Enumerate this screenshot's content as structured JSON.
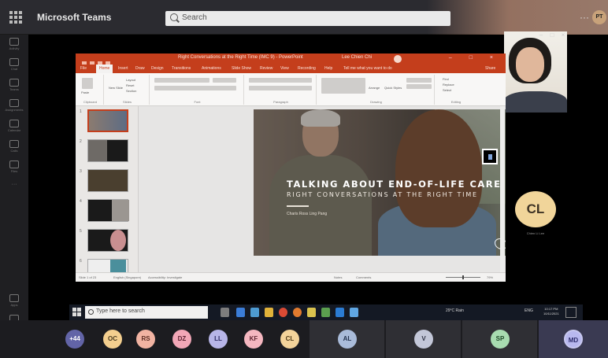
{
  "teams": {
    "app_title": "Microsoft Teams",
    "search_placeholder": "Search",
    "more": "···",
    "user_initials": "PT"
  },
  "rail": {
    "items": [
      "Activity",
      "Chat",
      "Teams",
      "Assignments",
      "Calendar",
      "Calls",
      "Files",
      "···"
    ],
    "bottom": [
      "Apps",
      "Help"
    ]
  },
  "self_window": {
    "controls": [
      "–",
      "□",
      "×"
    ]
  },
  "powerpoint": {
    "title": "Right Conversations at the Right Time (IMC 9) - PowerPoint",
    "user_name": "Lee Chien Chi",
    "tabs": [
      "File",
      "Home",
      "Insert",
      "Draw",
      "Design",
      "Transitions",
      "Animations",
      "Slide Show",
      "Review",
      "View",
      "Recording",
      "Help",
      "Tell me what you want to do",
      "Share"
    ],
    "active_tab": "Home",
    "ribbon_groups": [
      "Clipboard",
      "Slides",
      "Font",
      "Paragraph",
      "Drawing",
      "Editing"
    ],
    "ribbon_labels": {
      "layout": "Layout",
      "reset": "Reset",
      "section": "Section",
      "new_slide": "New Slide",
      "paste": "Paste",
      "find": "Find",
      "replace": "Replace",
      "select": "Select",
      "arrange": "Arrange",
      "quick_styles": "Quick Styles"
    },
    "thumbnails": [
      "1",
      "2",
      "3",
      "4",
      "5",
      "6"
    ],
    "status": {
      "slide": "Slide 1 of 23",
      "language": "English (Singapore)",
      "accessibility": "Accessibility: Investigate",
      "notes": "Notes",
      "comments": "Comments",
      "zoom": "79%"
    }
  },
  "slide": {
    "title": "TALKING ABOUT END-OF-LIFE CARE:",
    "subtitle": "RIGHT CONVERSATIONS AT THE RIGHT TIME",
    "author": "Charis Ross Ling Pang"
  },
  "participants": {
    "cl_initials": "CL",
    "cl_name": "Chien Li Lee",
    "strip": [
      {
        "label": "+44",
        "color": "#6264a7",
        "text": "#ffffff"
      },
      {
        "label": "OC",
        "color": "#f4cf8f",
        "text": "#4a3b1e"
      },
      {
        "label": "RS",
        "color": "#f1b3a2",
        "text": "#5b2c22"
      },
      {
        "label": "DZ",
        "color": "#f2a7b7",
        "text": "#5c2130"
      },
      {
        "label": "LL",
        "color": "#b7b5e8",
        "text": "#2d2b63"
      },
      {
        "label": "KF",
        "color": "#f5b7c0",
        "text": "#5e2430"
      },
      {
        "label": "CL",
        "color": "#f3d39a",
        "text": "#4f3b17"
      }
    ],
    "tiles": [
      {
        "label": "AL",
        "color": "#a9bbd9",
        "text": "#23324e"
      },
      {
        "label": "V",
        "color": "#c3c7d8",
        "text": "#2f3345"
      },
      {
        "label": "SP",
        "color": "#a8dcb0",
        "text": "#1e4a27"
      },
      {
        "label": "MD",
        "color": "#b8b8ef",
        "text": "#2b2a6a"
      }
    ]
  },
  "taskbar": {
    "search_placeholder": "Type here to search",
    "weather": "29°C Rain",
    "language": "ENG",
    "time": "10:17 PM",
    "date": "10/11/2021"
  }
}
